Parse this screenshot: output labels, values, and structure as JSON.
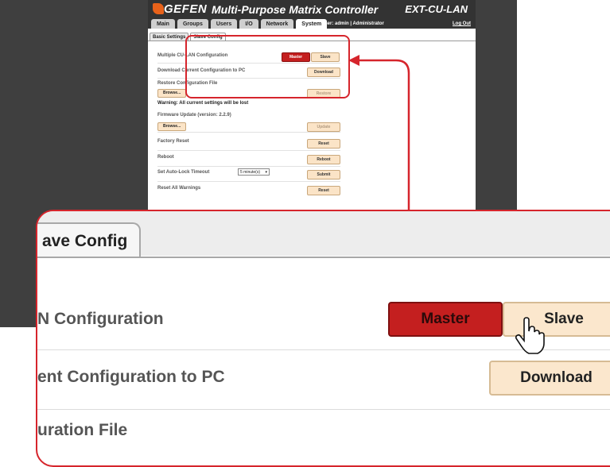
{
  "app": {
    "logo": "GEFEN",
    "title": "Multi-Purpose Matrix Controller",
    "model": "EXT-CU-LAN",
    "user_info": "User: admin  |  Administrator",
    "logout": "Log Out",
    "nav_tabs": [
      "Main",
      "Groups",
      "Users",
      "I/O",
      "Network",
      "System"
    ],
    "active_nav": "System",
    "subtabs": [
      "Basic Settings",
      "Slave Config"
    ],
    "active_subtab": "Slave Config"
  },
  "settings": {
    "multiple_config_label": "Multiple CU-LAN Configuration",
    "master_label": "Master",
    "slave_label": "Slave",
    "download_label": "Download Current Configuration to PC",
    "download_button": "Download",
    "restore_label": "Restore Configuration File",
    "browse_button": "Browse...",
    "restore_button": "Restore",
    "warning": "Warning: All current settings will be lost",
    "firmware_label": "Firmware Update (version: 2.2.9)",
    "update_button": "Update",
    "factory_reset_label": "Factory Reset",
    "reset_button": "Reset",
    "reboot_label": "Reboot",
    "reboot_button": "Reboot",
    "autolock_label": "Set Auto-Lock Timeout",
    "autolock_value": "5 minute(s)",
    "submit_button": "Submit",
    "reset_warnings_label": "Reset All Warnings"
  },
  "zoom": {
    "tab_label": "ave Config",
    "row1_label": "N Configuration",
    "master": "Master",
    "slave": "Slave",
    "row2_label": "ent Configuration to PC",
    "download": "Download",
    "row3_label": "uration File"
  },
  "colors": {
    "accent": "#d6252c",
    "master_active": "#c41f1f",
    "button_bg": "#fbe4c7",
    "header_bg": "#333333",
    "backdrop": "#3f3f3f"
  }
}
